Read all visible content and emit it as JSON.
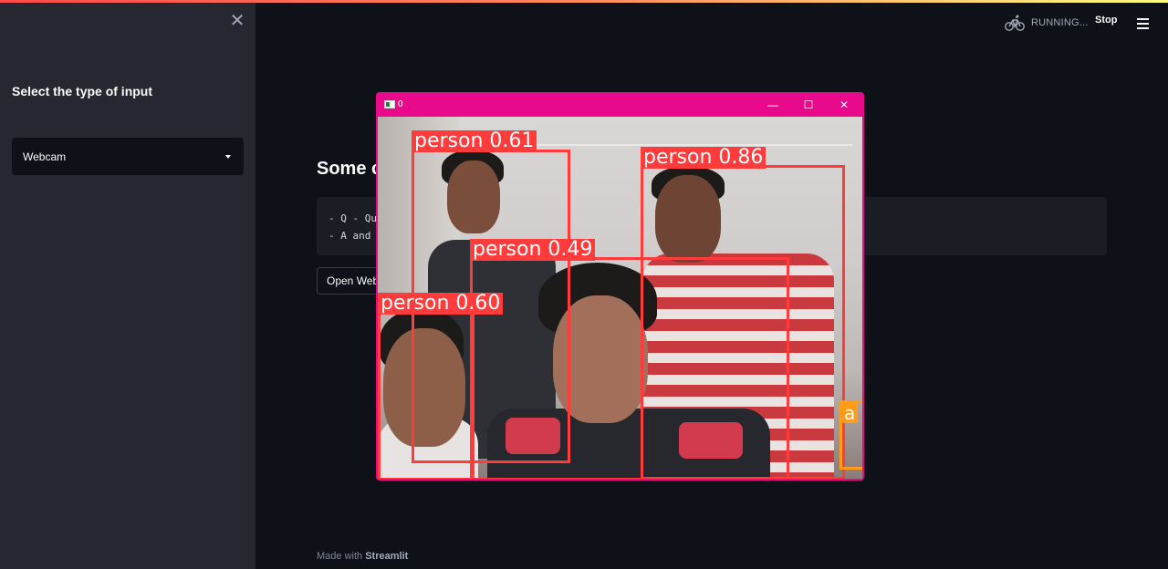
{
  "sidebar": {
    "title": "Select the type of input",
    "select_value": "Webcam"
  },
  "header": {
    "status": "RUNNING...",
    "stop_label": "Stop"
  },
  "main": {
    "heading": "Some c",
    "code_lines": [
      "- Q - Qu",
      "- A and"
    ],
    "open_button_label": "Open Web"
  },
  "footer": {
    "prefix": "Made with ",
    "brand": "Streamlit"
  },
  "cv_window": {
    "title": "0",
    "detections": [
      {
        "label": "person 0.61"
      },
      {
        "label": "person 0.86"
      },
      {
        "label": "person 0.49"
      },
      {
        "label": "person 0.60"
      },
      {
        "label": "a"
      }
    ]
  },
  "colors": {
    "background": "#0e1117",
    "sidebar": "#262730",
    "window_frame": "#e80a8a",
    "bbox_red": "#ff3b3b",
    "bbox_orange": "#ff9d1a"
  },
  "icons": {
    "close": "close-icon",
    "caret": "chevron-down-icon",
    "status": "bike-icon",
    "menu": "hamburger-menu-icon"
  }
}
